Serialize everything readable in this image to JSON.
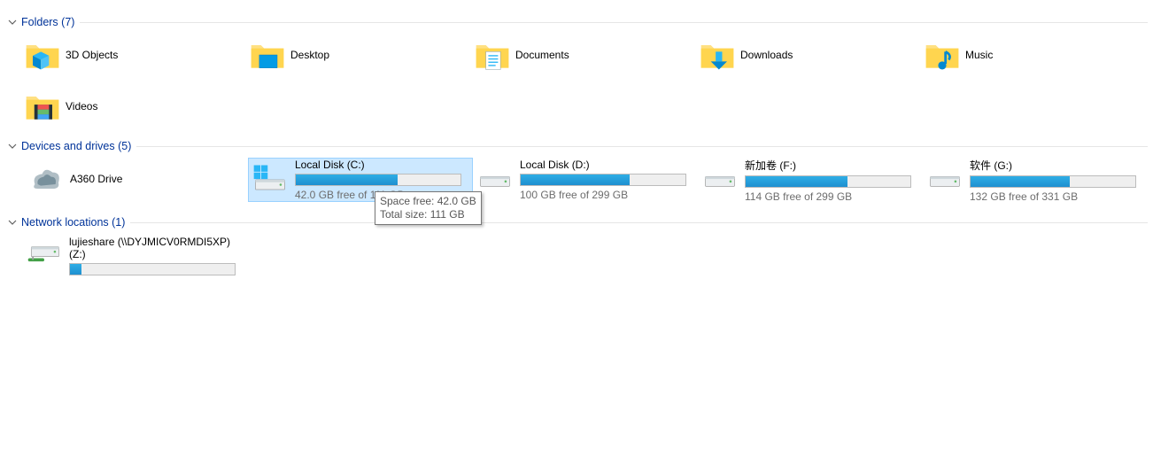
{
  "groups": {
    "folders": {
      "title": "Folders (7)"
    },
    "drives": {
      "title": "Devices and drives (5)"
    },
    "network": {
      "title": "Network locations (1)"
    }
  },
  "folders": [
    {
      "label": "3D Objects"
    },
    {
      "label": "Desktop"
    },
    {
      "label": "Documents"
    },
    {
      "label": "Downloads"
    },
    {
      "label": "Music"
    },
    {
      "label": "Videos"
    }
  ],
  "a360": {
    "label": "A360 Drive"
  },
  "drives": [
    {
      "name": "Local Disk (C:)",
      "sub": "42.0 GB free of 111 GB",
      "fill": 62,
      "os": true,
      "selected": true
    },
    {
      "name": "Local Disk (D:)",
      "sub": "100 GB free of 299 GB",
      "fill": 66
    },
    {
      "name": "新加卷 (F:)",
      "sub": "114 GB free of 299 GB",
      "fill": 62
    },
    {
      "name": "软件 (G:)",
      "sub": "132 GB free of 331 GB",
      "fill": 60
    }
  ],
  "network": {
    "name1": "lujieshare (\\\\DYJMICV0RMDI5XP)",
    "name2": "(Z:)",
    "fill": 7
  },
  "tooltip": {
    "line1": "Space free: 42.0 GB",
    "line2": "Total size: 111 GB"
  }
}
